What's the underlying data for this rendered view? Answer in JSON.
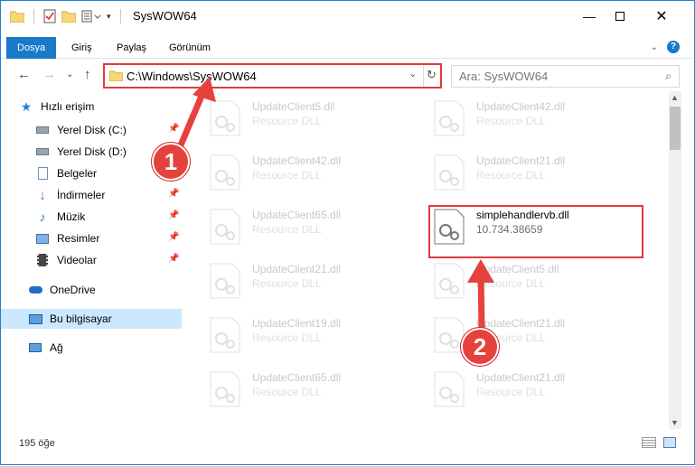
{
  "window": {
    "title": "SysWOW64",
    "controls": [
      "minimize-icon",
      "maximize-icon",
      "close-icon"
    ]
  },
  "ribbon": {
    "tabs": [
      "Dosya",
      "Giriş",
      "Paylaş",
      "Görünüm"
    ],
    "active_tab": "Dosya"
  },
  "address": {
    "path": "C:\\Windows\\SysWOW64",
    "search_placeholder": "Ara: SysWOW64"
  },
  "nav": {
    "quick_access": "Hızlı erişim",
    "items": [
      {
        "label": "Yerel Disk (C:)",
        "icon": "drive-icon",
        "pinned": true
      },
      {
        "label": "Yerel Disk (D:)",
        "icon": "drive-icon",
        "pinned": false
      },
      {
        "label": "Belgeler",
        "icon": "documents-icon",
        "pinned": true
      },
      {
        "label": "İndirmeler",
        "icon": "download-icon",
        "pinned": true
      },
      {
        "label": "Müzik",
        "icon": "music-icon",
        "pinned": true
      },
      {
        "label": "Resimler",
        "icon": "pictures-icon",
        "pinned": true
      },
      {
        "label": "Videolar",
        "icon": "videos-icon",
        "pinned": true
      }
    ],
    "onedrive": "OneDrive",
    "this_pc": "Bu bilgisayar",
    "network": "Ağ"
  },
  "files": {
    "left_column": [
      {
        "name": "UpdateClient5.dll",
        "type": "Resource DLL"
      },
      {
        "name": "UpdateClient42.dll",
        "type": "Resource DLL"
      },
      {
        "name": "UpdateClient65.dll",
        "type": "Resource DLL"
      },
      {
        "name": "UpdateClient21.dll",
        "type": "Resource DLL"
      },
      {
        "name": "UpdateClient19.dll",
        "type": "Resource DLL"
      },
      {
        "name": "UpdateClient65.dll",
        "type": "Resource DLL"
      }
    ],
    "right_column": [
      {
        "name": "UpdateClient42.dll",
        "type": "Resource DLL"
      },
      {
        "name": "UpdateClient21.dll",
        "type": "Resource DLL"
      },
      {
        "name": "UpdateClient5.dll",
        "type": "Resource DLL"
      },
      {
        "name": "UpdateClient21.dll",
        "type": "Resource DLL"
      },
      {
        "name": "UpdateClient21.dll",
        "type": "Resource DLL"
      }
    ],
    "highlighted": {
      "name": "simplehandlervb.dll",
      "version": "10.734.38659"
    }
  },
  "status": {
    "item_count": "195 öğe"
  },
  "callouts": [
    "1",
    "2"
  ],
  "colors": {
    "accent": "#1979ca",
    "highlight_red": "#e13a3a",
    "selected_nav": "#cce8ff"
  }
}
